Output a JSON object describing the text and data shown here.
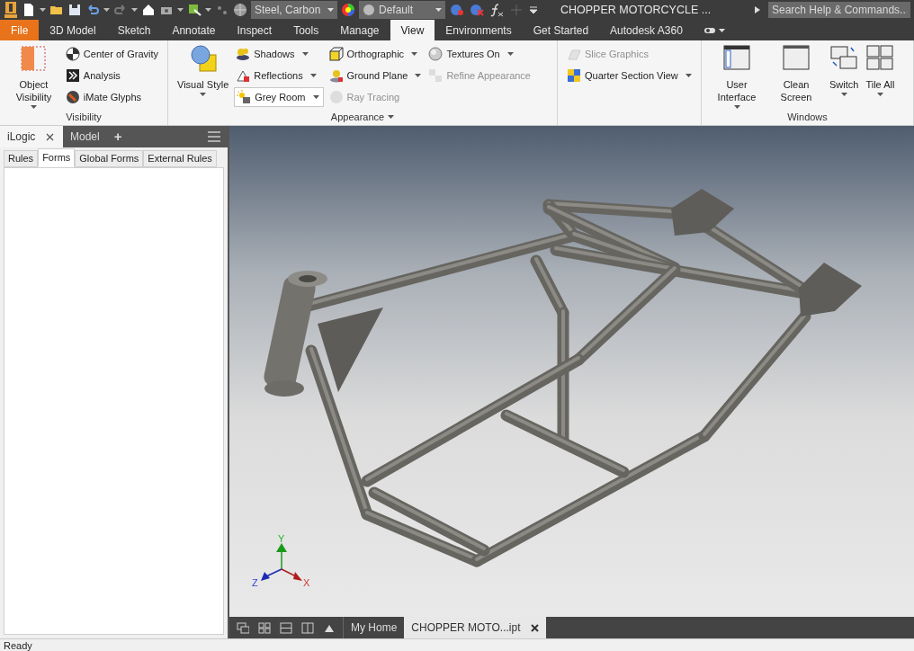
{
  "quick_access": {
    "material": "Steel, Carbon",
    "appearance": "Default",
    "title": "CHOPPER MOTORCYCLE ...",
    "search": {
      "placeholder": "Search Help & Commands..."
    }
  },
  "ribbon_tabs": [
    {
      "label": "File",
      "kind": "app",
      "selected": false
    },
    {
      "label": "3D Model",
      "kind": "tab",
      "selected": false
    },
    {
      "label": "Sketch",
      "kind": "tab",
      "selected": false
    },
    {
      "label": "Annotate",
      "kind": "tab",
      "selected": false
    },
    {
      "label": "Inspect",
      "kind": "tab",
      "selected": false
    },
    {
      "label": "Tools",
      "kind": "tab",
      "selected": false
    },
    {
      "label": "Manage",
      "kind": "tab",
      "selected": false
    },
    {
      "label": "View",
      "kind": "tab",
      "selected": true
    },
    {
      "label": "Environments",
      "kind": "tab",
      "selected": false
    },
    {
      "label": "Get Started",
      "kind": "tab",
      "selected": false
    },
    {
      "label": "Autodesk A360",
      "kind": "tab",
      "selected": false
    }
  ],
  "ribbon_panels": [
    {
      "title": "Visibility",
      "title_dropdown": false,
      "large": [
        {
          "label": "Object Visibility",
          "dropdown": true
        }
      ],
      "columns": [
        [
          {
            "label": "Center of Gravity",
            "kind": "button",
            "dropdown": false,
            "disabled": false
          },
          {
            "label": "Analysis",
            "kind": "button",
            "dropdown": false,
            "disabled": false
          },
          {
            "label": "iMate Glyphs",
            "kind": "button",
            "dropdown": false,
            "disabled": false
          }
        ]
      ]
    },
    {
      "title": "Appearance",
      "title_dropdown": true,
      "large": [
        {
          "label": "Visual Style",
          "dropdown": true
        }
      ],
      "columns": [
        [
          {
            "label": "Shadows",
            "kind": "button",
            "dropdown": true,
            "disabled": false
          },
          {
            "label": "Reflections",
            "kind": "button",
            "dropdown": true,
            "disabled": false
          },
          {
            "label": "Grey Room",
            "kind": "combo",
            "dropdown": true,
            "disabled": false
          }
        ],
        [
          {
            "label": "Orthographic",
            "kind": "button",
            "dropdown": true,
            "disabled": false
          },
          {
            "label": "Ground Plane",
            "kind": "button",
            "dropdown": true,
            "disabled": false
          },
          {
            "label": "Ray Tracing",
            "kind": "button",
            "dropdown": false,
            "disabled": true
          }
        ],
        [
          {
            "label": "Textures On",
            "kind": "button",
            "dropdown": true,
            "disabled": false
          },
          {
            "label": "Refine Appearance",
            "kind": "button",
            "dropdown": false,
            "disabled": true
          }
        ]
      ]
    },
    {
      "columns": [
        [
          {
            "label": "Slice Graphics",
            "kind": "button",
            "dropdown": false,
            "disabled": true
          },
          {
            "label": "Quarter Section View",
            "kind": "button",
            "dropdown": true,
            "disabled": false
          }
        ]
      ]
    },
    {
      "title": "Windows",
      "title_dropdown": false,
      "large": [
        {
          "label": "User Interface",
          "dropdown": true
        },
        {
          "label": "Clean Screen",
          "dropdown": false
        },
        {
          "label": "Switch",
          "dropdown": true
        },
        {
          "label": "Tile All",
          "dropdown": true
        }
      ]
    }
  ],
  "browser": {
    "tabs": [
      {
        "label": "iLogic",
        "selected": true,
        "closable": true
      },
      {
        "label": "Model",
        "selected": false,
        "closable": false
      }
    ],
    "add_tab": "+",
    "subtabs": [
      {
        "label": "Rules",
        "selected": false
      },
      {
        "label": "Forms",
        "selected": true
      },
      {
        "label": "Global Forms",
        "selected": false
      },
      {
        "label": "External Rules",
        "selected": false
      }
    ]
  },
  "viewport": {
    "axis_labels": [
      "Y",
      "Z",
      "X"
    ]
  },
  "document_tabs": [
    {
      "label": "My Home",
      "selected": false,
      "closable": false
    },
    {
      "label": "CHOPPER MOTO...ipt",
      "selected": true,
      "closable": true
    }
  ],
  "status_bar": {
    "text": "Ready"
  }
}
